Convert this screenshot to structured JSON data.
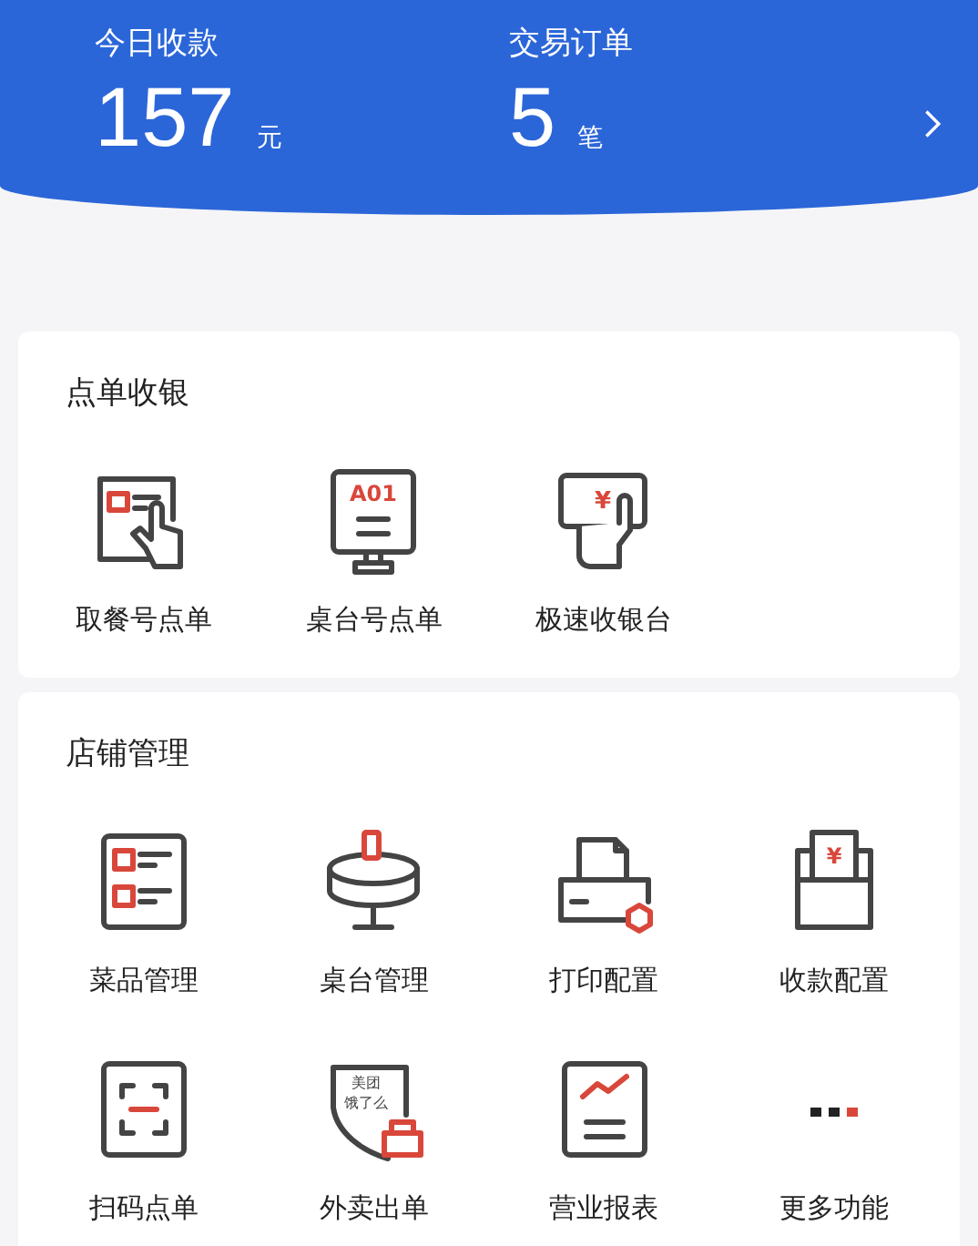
{
  "summary": {
    "stats": [
      {
        "label": "今日收款",
        "value": "157",
        "unit": "元"
      },
      {
        "label": "交易订单",
        "value": "5",
        "unit": "笔"
      }
    ]
  },
  "sections": [
    {
      "title": "点单收银",
      "items": [
        {
          "kind": "pickup",
          "label": "取餐号点单"
        },
        {
          "kind": "table-order",
          "label": "桌台号点单",
          "icon_text": [
            "A01"
          ]
        },
        {
          "kind": "cashier",
          "label": "极速收银台",
          "icon_text": [
            "¥"
          ]
        }
      ]
    },
    {
      "title": "店铺管理",
      "items": [
        {
          "kind": "menu",
          "label": "菜品管理"
        },
        {
          "kind": "table",
          "label": "桌台管理"
        },
        {
          "kind": "printer",
          "label": "打印配置"
        },
        {
          "kind": "payment",
          "label": "收款配置",
          "icon_text": [
            "¥"
          ]
        },
        {
          "kind": "scan",
          "label": "扫码点单"
        },
        {
          "kind": "delivery",
          "label": "外卖出单",
          "icon_text": [
            "美团",
            "饿了么"
          ]
        },
        {
          "kind": "report",
          "label": "营业报表"
        },
        {
          "kind": "more",
          "label": "更多功能"
        }
      ]
    }
  ]
}
